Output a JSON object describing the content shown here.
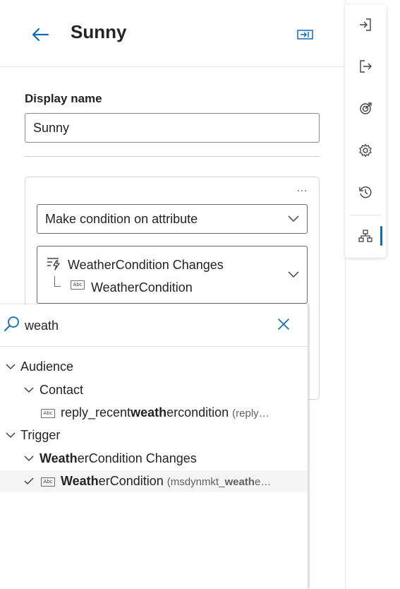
{
  "header": {
    "title": "Sunny"
  },
  "form": {
    "display_name_label": "Display name",
    "display_name_value": "Sunny"
  },
  "condition": {
    "more_label": "…",
    "type_value": "Make condition on attribute",
    "trigger_name": "WeatherCondition Changes",
    "attribute_name": "WeatherCondition",
    "abc_label": "Abc"
  },
  "search": {
    "value": "weath"
  },
  "results": {
    "audience_label": "Audience",
    "contact_label": "Contact",
    "contact_item": {
      "pre": "reply_recent",
      "bold": "weath",
      "post": "ercondition",
      "detail": "(reply…"
    },
    "trigger_label": "Trigger",
    "trigger_group": {
      "bold": "Weath",
      "post": "erCondition Changes"
    },
    "trigger_item": {
      "bold": "Weath",
      "post": "erCondition",
      "detail_pre": "(msdynmkt_",
      "detail_bold": "weath",
      "detail_post": "e…"
    }
  },
  "rail": {
    "icons": [
      "sign-in-icon",
      "sign-out-icon",
      "goal-icon",
      "settings-icon",
      "history-icon",
      "hierarchy-icon"
    ],
    "active": "hierarchy-icon"
  },
  "colors": {
    "accent": "#0f6cbd"
  }
}
